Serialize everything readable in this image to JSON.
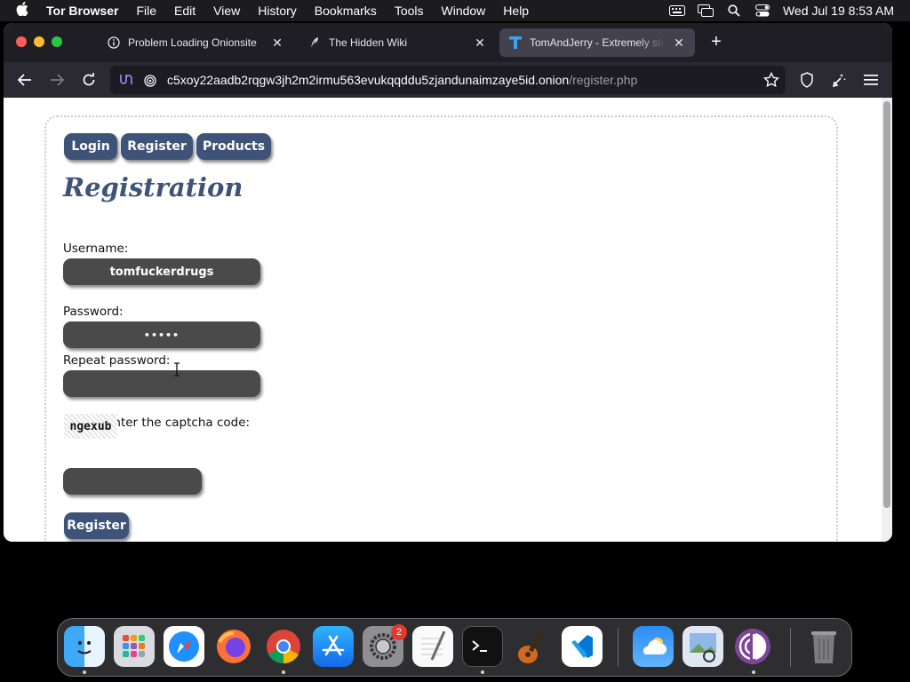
{
  "menubar": {
    "app_name": "Tor Browser",
    "menus": [
      "File",
      "Edit",
      "View",
      "History",
      "Bookmarks",
      "Tools",
      "Window",
      "Help"
    ],
    "clock": "Wed Jul 19  8:53 AM"
  },
  "tabs": [
    {
      "title": "Problem Loading Onionsite",
      "icon": "info-icon"
    },
    {
      "title": "The Hidden Wiki",
      "icon": "feather-icon"
    },
    {
      "title": "TomAndJerry - Extremely stealt",
      "icon": "t-logo-icon",
      "active": true
    }
  ],
  "url": {
    "host": "c5xoy22aadb2rqgw3jh2m2irmu563evukqqddu5zjandunaimzaye5id.onion",
    "path": "/register.php"
  },
  "page": {
    "nav": [
      "Login",
      "Register",
      "Products"
    ],
    "title": "Registration",
    "username_label": "Username:",
    "username_value": "tomfuckerdrugs",
    "password_label": "Password:",
    "password_value": "•••••",
    "repeat_label": "Repeat password:",
    "repeat_value": "",
    "captcha_label": "Please enter the captcha code:",
    "captcha_code": "ngexub",
    "captcha_value": "",
    "submit_label": "Register"
  },
  "dock": {
    "apps": [
      "Finder",
      "Launchpad",
      "Safari",
      "Firefox",
      "Chrome",
      "App Store",
      "System Settings",
      "TextEdit",
      "Terminal",
      "GarageBand",
      "VS Code",
      "Weather",
      "Preview",
      "Tor Browser",
      "Trash"
    ],
    "settings_badge": "2"
  },
  "colors": {
    "accent": "#3e5377",
    "field_bg": "#4a4a4a",
    "tabbar_bg": "#1f1e25",
    "navbar_bg": "#2b2a33"
  }
}
